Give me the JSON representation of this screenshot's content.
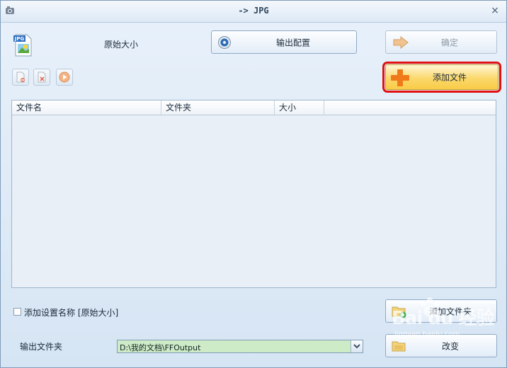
{
  "window": {
    "title": "-> JPG",
    "close_label": "×"
  },
  "header": {
    "format_icon_label": "JPG",
    "size_label": "原始大小"
  },
  "buttons": {
    "config_label": "输出配置",
    "ok_label": "确定",
    "add_file_label": "添加文件",
    "add_folder_label": "添加文件夹",
    "change_label": "改变"
  },
  "toolbar": {
    "icons": [
      "remove-icon",
      "clear-icon",
      "play-icon"
    ]
  },
  "file_table": {
    "columns": [
      "文件名",
      "文件夹",
      "大小",
      ""
    ],
    "rows": []
  },
  "options": {
    "add_setting_name_label": "添加设置名称 [原始大小]",
    "add_setting_name_checked": false
  },
  "output": {
    "folder_label": "输出文件夹",
    "folder_path": "D:\\我的文档\\FFOutput"
  },
  "watermark": {
    "text": "Bai du 经验",
    "sub": "jingyan.baidu.com"
  },
  "colors": {
    "highlight": "#e01010",
    "path_bg": "#cdebc6",
    "add_file_bg": "#fbd86c"
  }
}
